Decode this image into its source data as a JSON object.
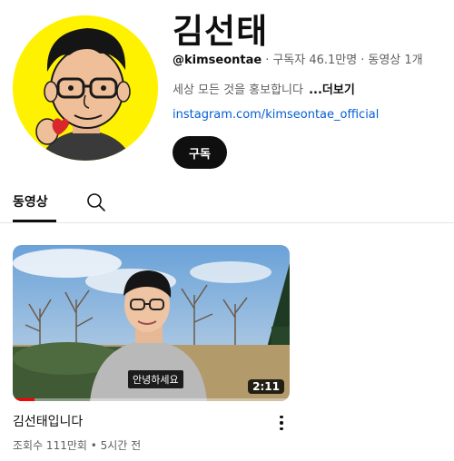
{
  "channel": {
    "name": "김선태",
    "handle": "@kimseontae",
    "subscribers": "구독자 46.1만명",
    "video_count": "동영상 1개",
    "description": "세상 모든 것을 홍보합니다",
    "more_label": "...더보기",
    "link": "instagram.com/kimseontae_official",
    "subscribe_label": "구독",
    "avatar_bg_color": "#fff200"
  },
  "tabs": {
    "videos_label": "동영상",
    "search_icon": "search-icon"
  },
  "video": {
    "title": "김선태입니다",
    "meta": "조회수 111만회 • 5시간 전",
    "duration": "2:11",
    "caption": "안녕하세요",
    "watched_fraction": 0.08,
    "progress_color": "#ff0000"
  }
}
